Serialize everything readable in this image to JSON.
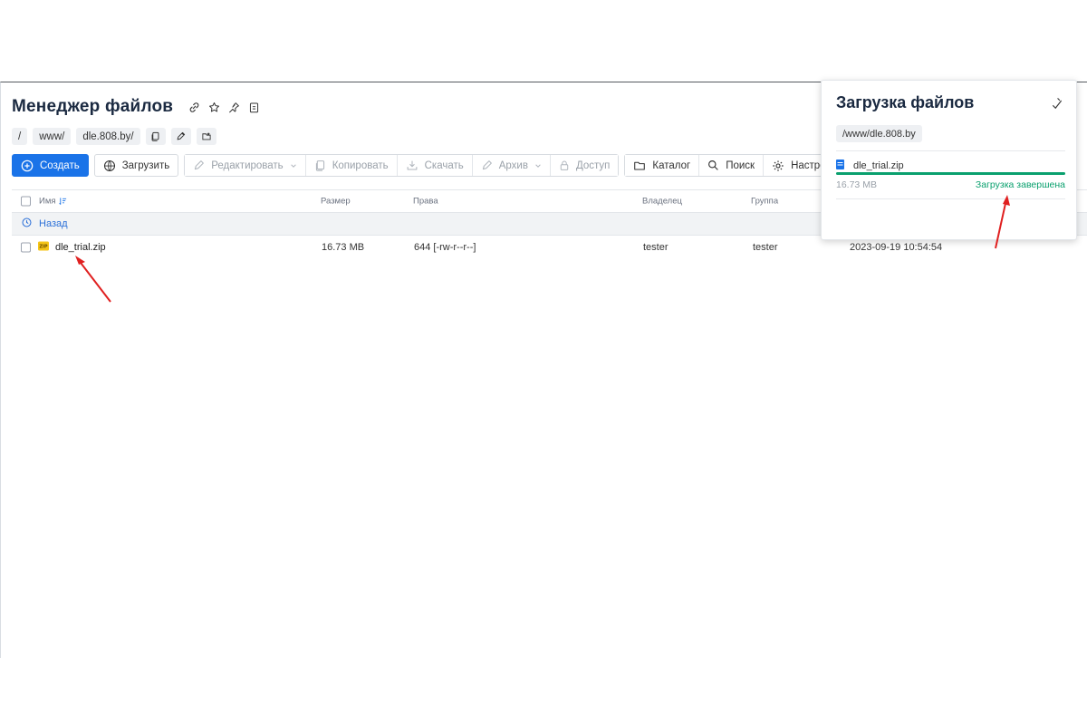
{
  "header": {
    "title": "Менеджер файлов",
    "icons": [
      "link-icon",
      "star-icon",
      "pin-icon",
      "clipboard-icon"
    ]
  },
  "breadcrumb": {
    "items": [
      "/",
      "www/",
      "dle.808.by/"
    ],
    "actions": [
      "copy-icon",
      "pencil-icon",
      "bookmark-icon"
    ]
  },
  "toolbar": {
    "create": "Создать",
    "upload": "Загрузить",
    "edit": "Редактировать",
    "copy": "Копировать",
    "download": "Скачать",
    "archive": "Архив",
    "access": "Доступ",
    "catalog": "Каталог",
    "search": "Поиск",
    "settings": "Настройки"
  },
  "table": {
    "columns": {
      "name": "Имя",
      "size": "Размер",
      "rights": "Права",
      "owner": "Владелец",
      "group": "Группа"
    },
    "back_label": "Назад",
    "rows": [
      {
        "name": "dle_trial.zip",
        "size": "16.73 MB",
        "rights": "644 [-rw-r--r--]",
        "owner": "tester",
        "group": "tester",
        "modified": "2023-09-19 10:54:54"
      }
    ]
  },
  "upload_panel": {
    "title": "Загрузка файлов",
    "path": "/www/dle.808.by",
    "file": {
      "name": "dle_trial.zip",
      "size": "16.73 MB",
      "status": "Загрузка завершена",
      "progress": 100
    }
  },
  "colors": {
    "accent": "#1a73e8",
    "success": "#0aa06e",
    "annotation_arrow": "#e02020"
  }
}
